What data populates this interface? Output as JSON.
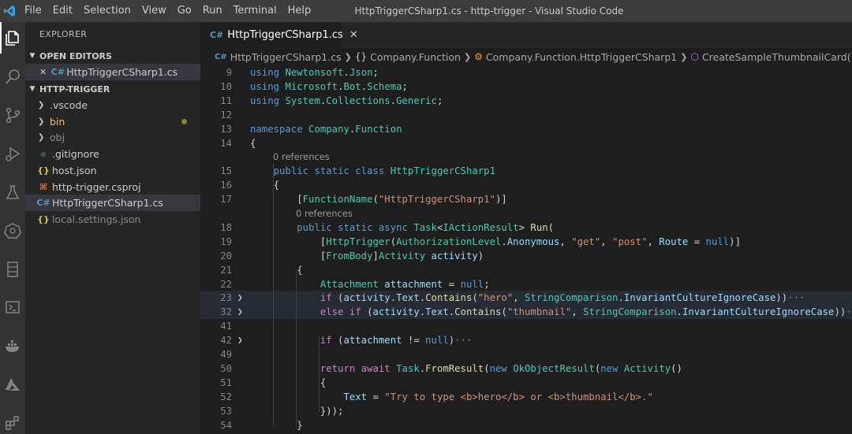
{
  "window": {
    "title": "HttpTriggerCSharp1.cs - http-trigger - Visual Studio Code",
    "menu": [
      "File",
      "Edit",
      "Selection",
      "View",
      "Go",
      "Run",
      "Terminal",
      "Help"
    ]
  },
  "activity_bar": [
    "files-icon",
    "search-icon",
    "source-control-icon",
    "run-debug-icon",
    "testing-icon",
    "kubernetes-icon",
    "remote-explorer-icon",
    "azure-functions-icon",
    "docker-icon",
    "azure-icon",
    "extensions-icon"
  ],
  "sidebar": {
    "title": "EXPLORER",
    "open_editors_header": "OPEN EDITORS",
    "open_editors": [
      {
        "close": "✕",
        "icon": "C#",
        "name": "HttpTriggerCSharp1.cs"
      }
    ],
    "project_header": "HTTP-TRIGGER",
    "tree": [
      {
        "name": ".vscode",
        "type": "folder"
      },
      {
        "name": "bin",
        "type": "folder",
        "modified": true
      },
      {
        "name": "obj",
        "type": "folder"
      },
      {
        "name": ".gitignore",
        "type": "file",
        "icon": "◆"
      },
      {
        "name": "host.json",
        "type": "file",
        "icon": "{}"
      },
      {
        "name": "http-trigger.csproj",
        "type": "file",
        "icon": "⌘"
      },
      {
        "name": "HttpTriggerCSharp1.cs",
        "type": "file",
        "icon": "C#",
        "selected": true
      },
      {
        "name": "local.settings.json",
        "type": "file",
        "icon": "{}"
      }
    ]
  },
  "tab": {
    "label": "HttpTriggerCSharp1.cs",
    "close": "✕"
  },
  "breadcrumb": [
    "HttpTriggerCSharp1.cs",
    "Company.Function",
    "Company.Function.HttpTriggerCSharp1",
    "CreateSampleThumbnailCard()"
  ],
  "code_lens": {
    "label": "0 references"
  },
  "editor_lines": [
    {
      "n": "9",
      "text": "using Newtonsoft.Json;"
    },
    {
      "n": "10",
      "text": "using Microsoft.Bot.Schema;"
    },
    {
      "n": "11",
      "text": "using System.Collections.Generic;"
    },
    {
      "n": "12",
      "text": ""
    },
    {
      "n": "13",
      "text": "namespace Company.Function"
    },
    {
      "n": "14",
      "text": "{"
    },
    {
      "n": "15",
      "text": "    public static class HttpTriggerCSharp1"
    },
    {
      "n": "16",
      "text": "    {"
    },
    {
      "n": "17",
      "text": "        [FunctionName(\"HttpTriggerCSharp1\")]"
    },
    {
      "n": "18",
      "text": "        public static async Task<IActionResult> Run("
    },
    {
      "n": "19",
      "text": "            [HttpTrigger(AuthorizationLevel.Anonymous, \"get\", \"post\", Route = null)]"
    },
    {
      "n": "20",
      "text": "            [FromBody]Activity activity)"
    },
    {
      "n": "21",
      "text": "        {"
    },
    {
      "n": "22",
      "text": "            Attachment attachment = null;"
    },
    {
      "n": "23",
      "text": "            if (activity.Text.Contains(\"hero\", StringComparison.InvariantCultureIgnoreCase))···"
    },
    {
      "n": "32",
      "text": "            else if (activity.Text.Contains(\"thumbnail\", StringComparison.InvariantCultureIgnoreCase))···"
    },
    {
      "n": "41",
      "text": ""
    },
    {
      "n": "42",
      "text": "            if (attachment != null)···"
    },
    {
      "n": "49",
      "text": ""
    },
    {
      "n": "50",
      "text": "            return await Task.FromResult(new OkObjectResult(new Activity()"
    },
    {
      "n": "51",
      "text": "            {"
    },
    {
      "n": "52",
      "text": "                Text = \"Try to type <b>hero</b> or <b>thumbnail</b>.\""
    },
    {
      "n": "53",
      "text": "            }));"
    },
    {
      "n": "54",
      "text": "        }"
    }
  ],
  "colors": {
    "keyword": "#569cd6",
    "control": "#c586c0",
    "type": "#4ec9b0",
    "string": "#ce9178",
    "variable": "#9cdcfe",
    "function": "#dcdcaa",
    "text": "#d4d4d4"
  }
}
